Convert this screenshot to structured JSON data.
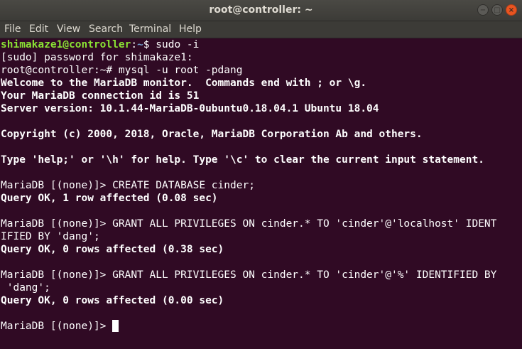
{
  "window": {
    "title": "root@controller: ~",
    "minimize_glyph": "−",
    "maximize_glyph": "□",
    "close_glyph": "×"
  },
  "menubar": {
    "items": [
      "File",
      "Edit",
      "View",
      "Search",
      "Terminal",
      "Help"
    ]
  },
  "terminal": {
    "prompt_user": "shimakaze1@controller",
    "prompt_sep": ":",
    "prompt_path": "~",
    "prompt_end": "$ sudo -i",
    "lines": [
      "[sudo] password for shimakaze1:",
      "root@controller:~# mysql -u root -pdang",
      "Welcome to the MariaDB monitor.  Commands end with ; or \\g.",
      "Your MariaDB connection id is 51",
      "Server version: 10.1.44-MariaDB-0ubuntu0.18.04.1 Ubuntu 18.04",
      "Copyright (c) 2000, 2018, Oracle, MariaDB Corporation Ab and others.",
      "Type 'help;' or '\\h' for help. Type '\\c' to clear the current input statement.",
      "MariaDB [(none)]> CREATE DATABASE cinder;",
      "Query OK, 1 row affected (0.08 sec)",
      "MariaDB [(none)]> GRANT ALL PRIVILEGES ON cinder.* TO 'cinder'@'localhost' IDENT",
      "IFIED BY 'dang';",
      "Query OK, 0 rows affected (0.38 sec)",
      "MariaDB [(none)]> GRANT ALL PRIVILEGES ON cinder.* TO 'cinder'@'%' IDENTIFIED BY",
      " 'dang';",
      "Query OK, 0 rows affected (0.00 sec)",
      "MariaDB [(none)]> "
    ]
  },
  "colors": {
    "background": "#300a24",
    "text": "#ffffff",
    "prompt_user": "#8ae234",
    "prompt_path": "#729fcf",
    "titlebar": "#3c3b37",
    "close_button": "#e95420"
  }
}
